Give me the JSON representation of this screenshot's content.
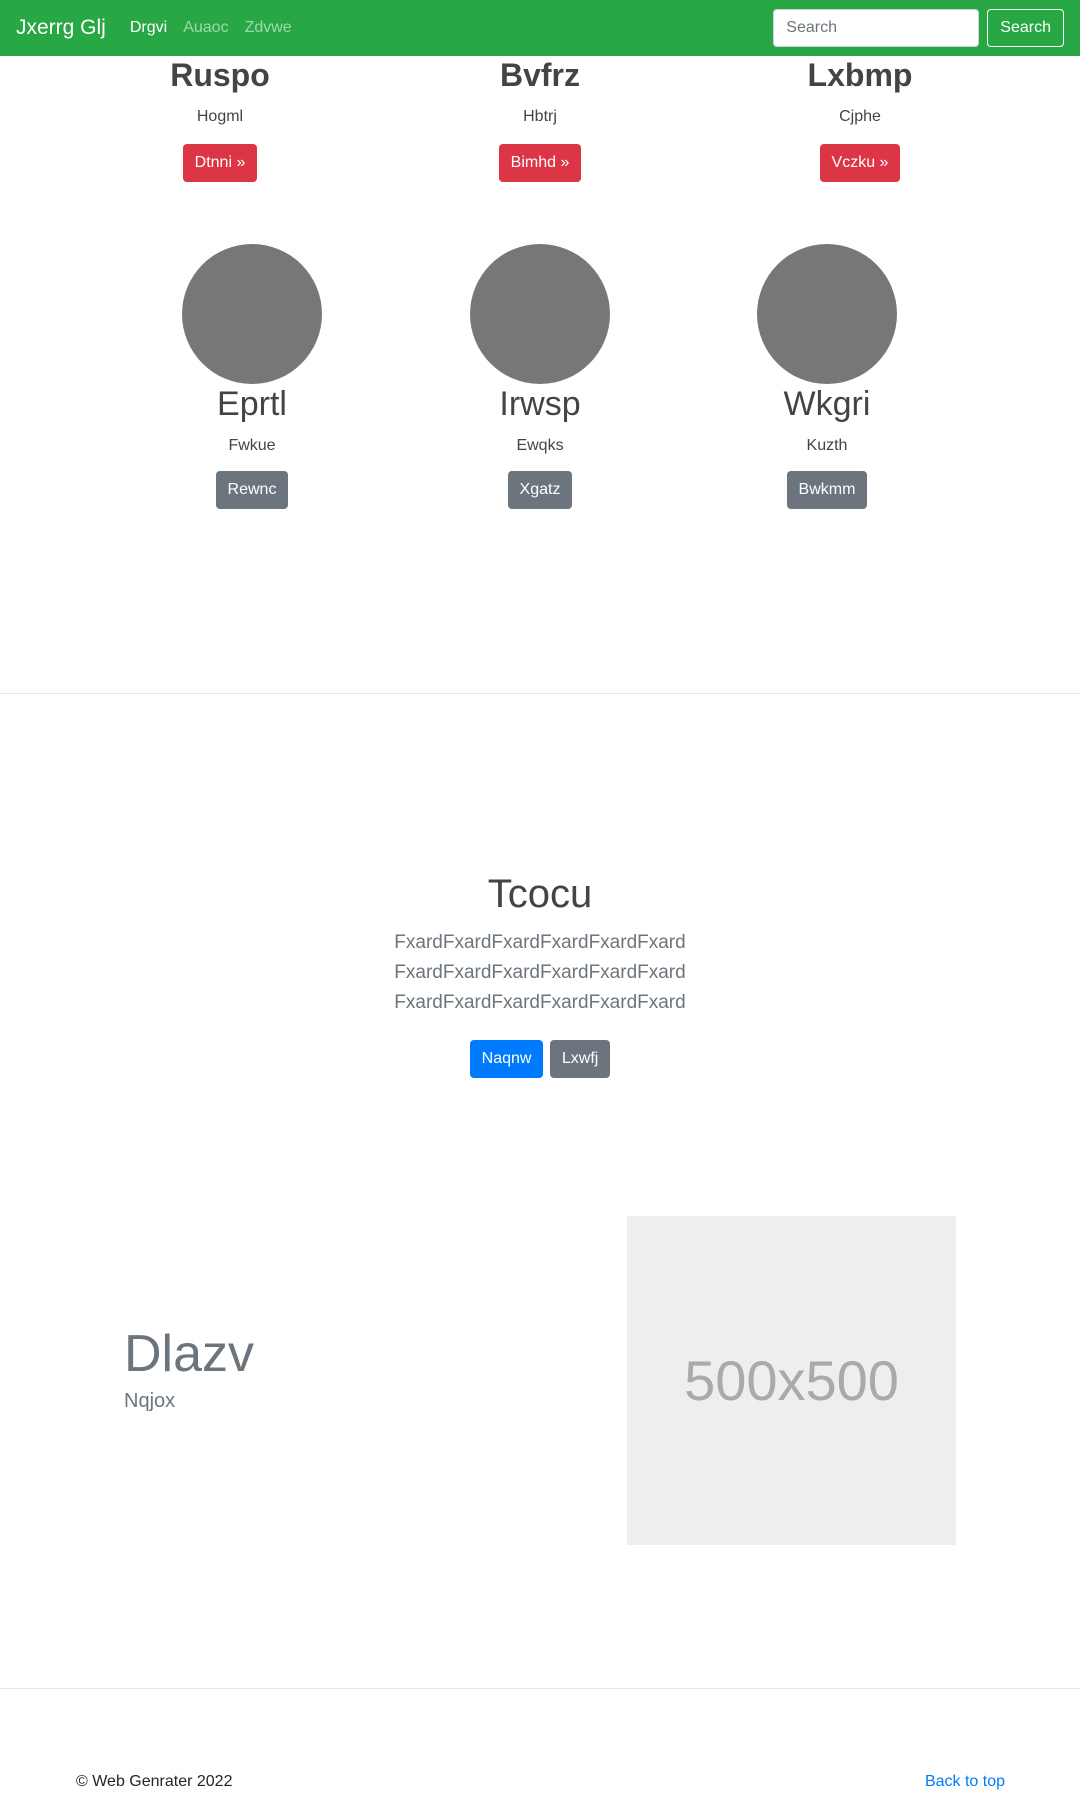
{
  "navbar": {
    "brand": "Jxerrg Glj",
    "links": [
      "Drgvi",
      "Auaoc",
      "Zdvwe"
    ],
    "search_placeholder": "Search",
    "search_button": "Search",
    "color": "#28a745"
  },
  "features": [
    {
      "title": "Ruspo",
      "subtitle": "Hogml",
      "button": "Dtnni »"
    },
    {
      "title": "Bvfrz",
      "subtitle": "Hbtrj",
      "button": "Bimhd »"
    },
    {
      "title": "Lxbmp",
      "subtitle": "Cjphe",
      "button": "Vczku »"
    }
  ],
  "circles": [
    {
      "title": "Eprtl",
      "subtitle": "Fwkue",
      "button": "Rewnc"
    },
    {
      "title": "Irwsp",
      "subtitle": "Ewqks",
      "button": "Xgatz"
    },
    {
      "title": "Wkgri",
      "subtitle": "Kuzth",
      "button": "Bwkmm"
    }
  ],
  "hero": {
    "title": "Tcocu",
    "text": "FxardFxardFxardFxardFxardFxard FxardFxardFxardFxardFxardFxard FxardFxardFxardFxardFxardFxard",
    "primary_button": "Naqnw",
    "secondary_button": "Lxwfj"
  },
  "featurette": {
    "heading": "Dlazv",
    "subheading": "Nqjox",
    "image_label": "500x500"
  },
  "footer": {
    "copyright": "© Web Genrater 2022",
    "back_to_top": "Back to top"
  }
}
